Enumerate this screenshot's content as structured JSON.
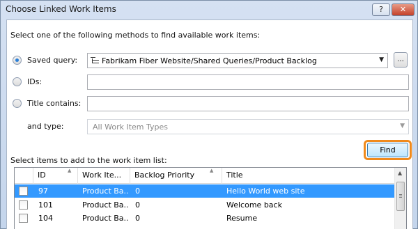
{
  "window": {
    "title": "Choose Linked Work Items",
    "help_label": "?",
    "close_label": "✕"
  },
  "instructions": "Select one of the following methods to find available work items:",
  "methods": {
    "saved_query": {
      "label": "Saved query:",
      "selected": true,
      "value": "Fabrikam Fiber Website/Shared Queries/Product Backlog",
      "browse_label": "..."
    },
    "ids": {
      "label": "IDs:",
      "selected": false,
      "value": ""
    },
    "title_contains": {
      "label": "Title contains:",
      "selected": false,
      "value": ""
    },
    "type": {
      "label": "and type:",
      "value": "All Work Item Types"
    }
  },
  "find_label": "Find",
  "list_label": "Select items to add to the work item list:",
  "grid": {
    "columns": [
      "ID",
      "Work Ite...",
      "Backlog Priority",
      "Title"
    ],
    "rows": [
      {
        "id": "97",
        "type": "Product Ba...",
        "priority": "0",
        "title": "Hello World web site",
        "selected": true
      },
      {
        "id": "101",
        "type": "Product Ba...",
        "priority": "0",
        "title": "Welcome back",
        "selected": false
      },
      {
        "id": "104",
        "type": "Product Ba...",
        "priority": "0",
        "title": "Resume",
        "selected": false
      }
    ]
  },
  "icons": {
    "dropdown": "chevron-down-icon",
    "query": "tree-query-icon",
    "sort": "sort-ascending-icon"
  },
  "colors": {
    "selection": "#3399ff",
    "highlight_ring": "#f08a1c",
    "radio_checked": "#2a7fd8"
  }
}
